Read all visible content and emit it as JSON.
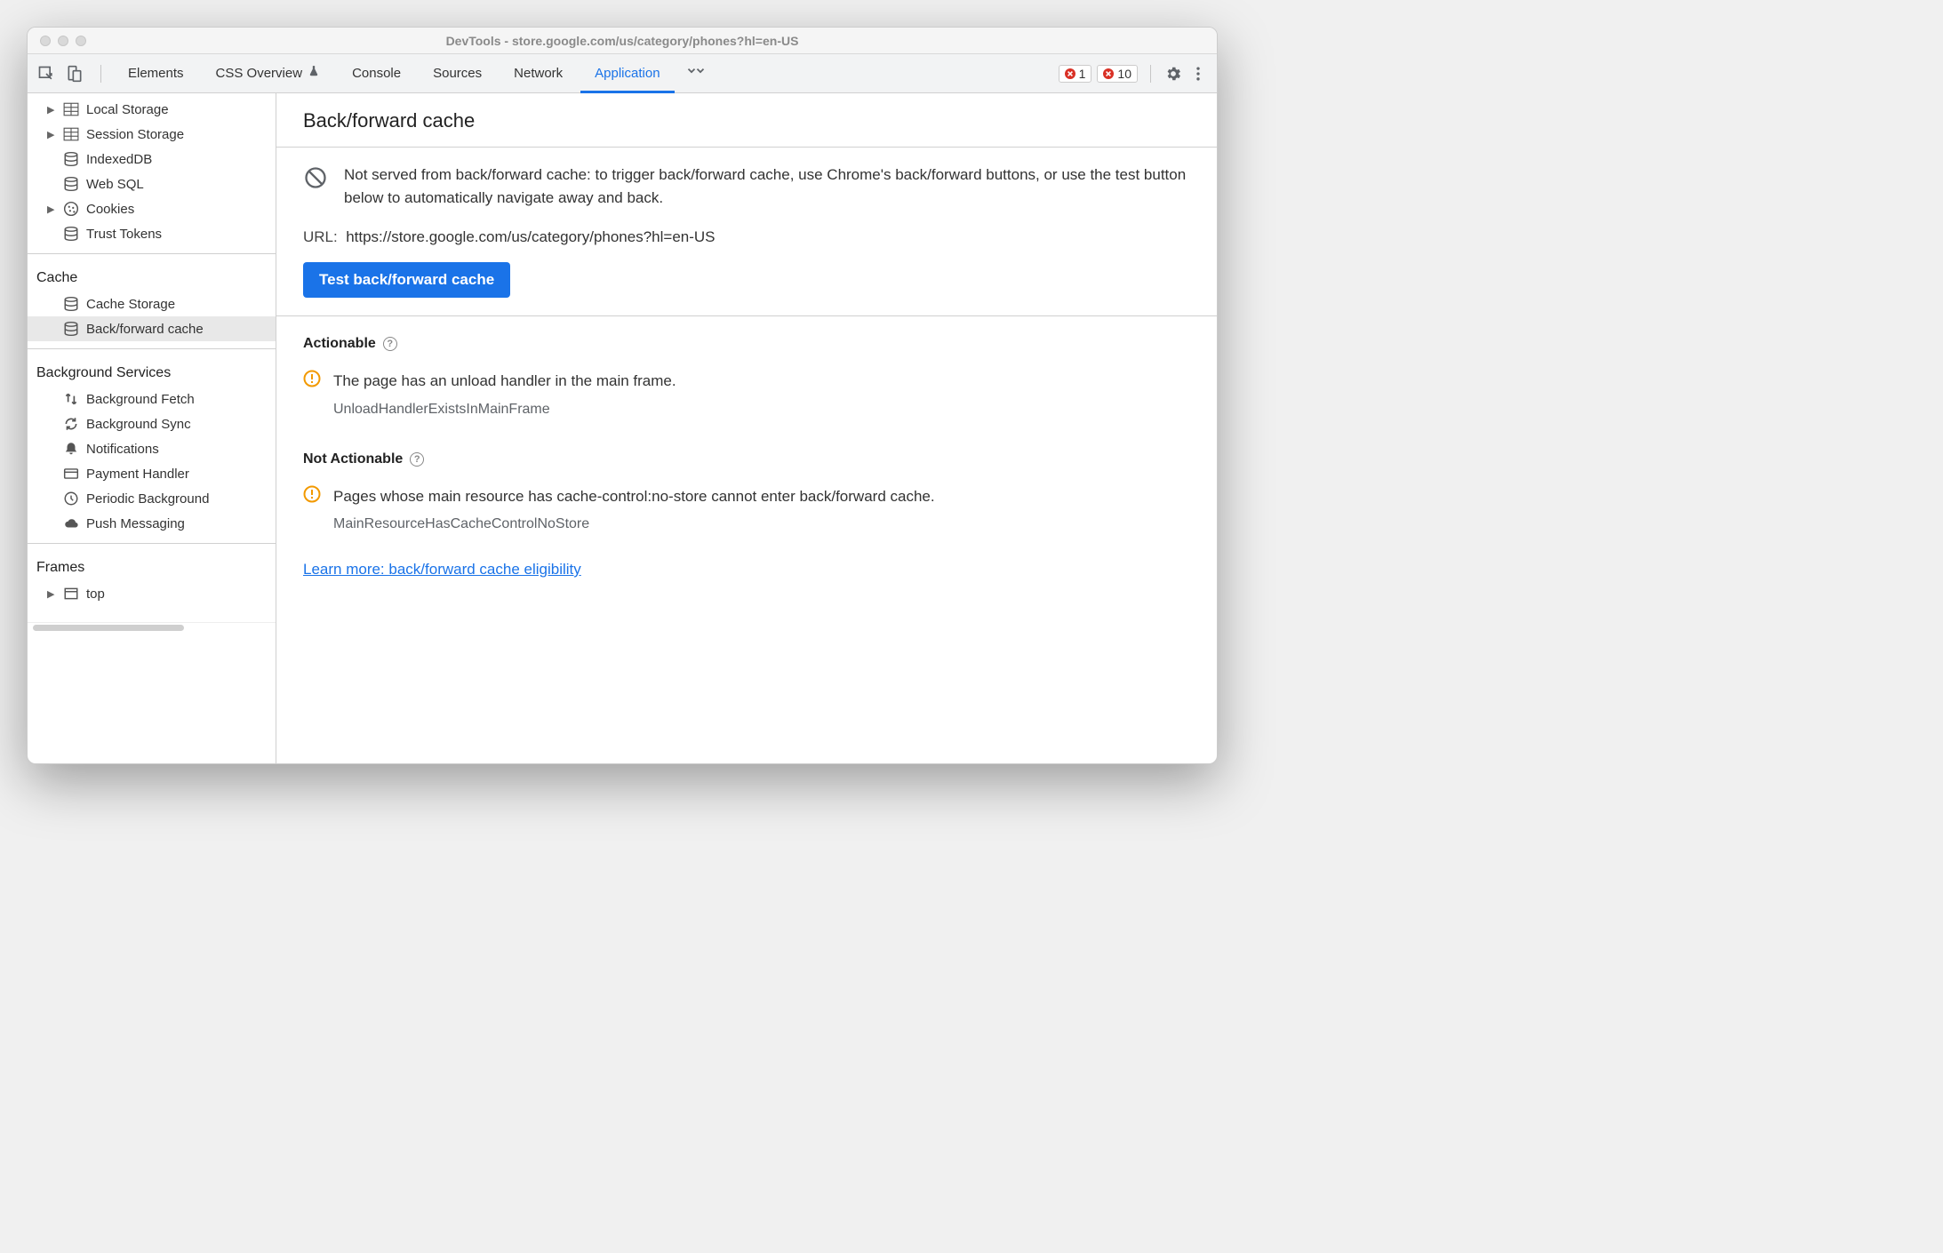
{
  "window": {
    "title": "DevTools - store.google.com/us/category/phones?hl=en-US"
  },
  "toolbar": {
    "tabs": {
      "elements": "Elements",
      "css_overview": "CSS Overview",
      "console": "Console",
      "sources": "Sources",
      "network": "Network",
      "application": "Application"
    },
    "error_badge_1": "1",
    "error_badge_2": "10"
  },
  "sidebar": {
    "storage": {
      "local": "Local Storage",
      "session": "Session Storage",
      "indexeddb": "IndexedDB",
      "websql": "Web SQL",
      "cookies": "Cookies",
      "trust": "Trust Tokens"
    },
    "cache": {
      "heading": "Cache",
      "cache_storage": "Cache Storage",
      "bfcache": "Back/forward cache"
    },
    "bg": {
      "heading": "Background Services",
      "fetch": "Background Fetch",
      "sync": "Background Sync",
      "notif": "Notifications",
      "payment": "Payment Handler",
      "periodic": "Periodic Background",
      "push": "Push Messaging"
    },
    "frames": {
      "heading": "Frames",
      "top": "top"
    }
  },
  "main": {
    "heading": "Back/forward cache",
    "banner": "Not served from back/forward cache: to trigger back/forward cache, use Chrome's back/forward buttons, or use the test button below to automatically navigate away and back.",
    "url_label": "URL:",
    "url_value": "https://store.google.com/us/category/phones?hl=en-US",
    "test_button": "Test back/forward cache",
    "actionable_h": "Actionable",
    "actionable_issue": "The page has an unload handler in the main frame.",
    "actionable_code": "UnloadHandlerExistsInMainFrame",
    "notactionable_h": "Not Actionable",
    "notactionable_issue": "Pages whose main resource has cache-control:no-store cannot enter back/forward cache.",
    "notactionable_code": "MainResourceHasCacheControlNoStore",
    "learn_more": "Learn more: back/forward cache eligibility"
  }
}
